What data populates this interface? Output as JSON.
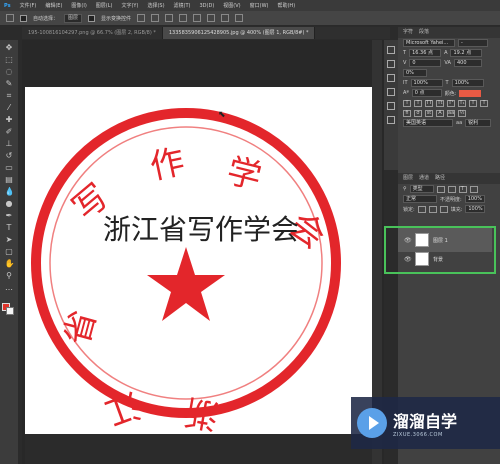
{
  "menu": [
    "文件(F)",
    "编辑(E)",
    "图像(I)",
    "图层(L)",
    "文字(Y)",
    "选择(S)",
    "滤镜(T)",
    "3D(D)",
    "视图(V)",
    "窗口(W)",
    "帮助(H)"
  ],
  "options": {
    "auto_select_label": "自动选择：",
    "auto_select_value": "图层",
    "show_transform_label": "显示变换控件"
  },
  "tabs": [
    {
      "label": "195-100816104297.png @ 66.7% (图层 2, RGB/8) *",
      "active": false
    },
    {
      "label": "1335835906125428905.jpg @ 400% (图层 1, RGB/8#) *",
      "active": true
    }
  ],
  "panel": {
    "tabs": [
      "字符",
      "段落"
    ],
    "font": "Microsoft Yahei...",
    "font_style": "-",
    "size": "16.36 点",
    "leading": "19.2 点",
    "tracking": "0",
    "kerning": "400",
    "scale_v": "100%",
    "scale_h": "100%",
    "baseline": "0 点",
    "color_label": "颜色:",
    "aa_language": "美国英语",
    "aa_mode": "锐利"
  },
  "layers": {
    "tabs": [
      "图层",
      "通道",
      "路径"
    ],
    "kind": "类型",
    "blend": "正常",
    "opacity_label": "不透明度:",
    "opacity": "100%",
    "lock_label": "锁定:",
    "fill_label": "填充:",
    "fill": "100%",
    "items": [
      {
        "name": "图层 1",
        "selected": true
      },
      {
        "name": "背景",
        "selected": false
      }
    ]
  },
  "stamp": {
    "top_arc": "作 学 写 作",
    "bottom_arc": "浙 江 省 写",
    "overlay_text": "浙江省写作学会",
    "stamp_color": "#e3262b"
  },
  "watermark": {
    "brand": "溜溜自学",
    "url": "ZIXUE.3066.COM"
  }
}
